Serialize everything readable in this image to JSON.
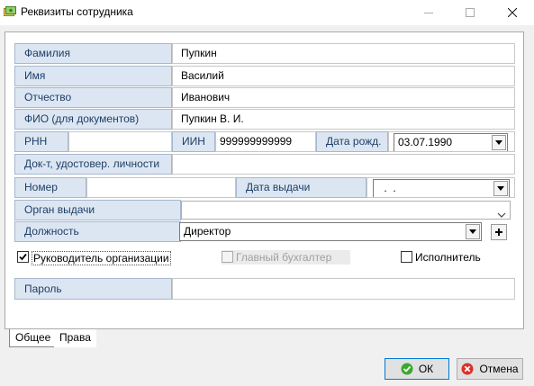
{
  "window": {
    "title": "Реквизиты сотрудника",
    "icons": [
      "app-icon",
      "minimize-icon",
      "maximize-icon",
      "close-icon"
    ]
  },
  "form": {
    "last_name": {
      "label": "Фамилия",
      "value": "Пупкин"
    },
    "first_name": {
      "label": "Имя",
      "value": "Василий"
    },
    "patronymic": {
      "label": "Отчество",
      "value": "Иванович"
    },
    "full_name_docs": {
      "label": "ФИО (для документов)",
      "value": "Пупкин В. И."
    },
    "rnn": {
      "label": "РНН",
      "value": ""
    },
    "iin": {
      "label": "ИИН",
      "value": "999999999999"
    },
    "birth_date": {
      "label": "Дата рожд.",
      "value": "03.07.1990"
    },
    "id_document": {
      "label": "Док-т, удостовер. личности",
      "value": ""
    },
    "doc_number": {
      "label": "Номер",
      "value": ""
    },
    "issue_date": {
      "label": "Дата выдачи",
      "value": " .  ."
    },
    "issuer": {
      "label": "Орган выдачи",
      "value": ""
    },
    "position": {
      "label": "Должность",
      "value": "Директор",
      "add_icon": "plus-icon"
    },
    "is_head": {
      "label": "Руководитель организации",
      "checked": true
    },
    "chief_accountant": {
      "label": "Главный бухгалтер",
      "checked": false,
      "disabled": true
    },
    "executor": {
      "label": "Исполнитель",
      "checked": false
    },
    "password": {
      "label": "Пароль",
      "value": ""
    }
  },
  "tabs": [
    {
      "label": "Общее",
      "active": true
    },
    {
      "label": "Права",
      "active": false
    }
  ],
  "buttons": {
    "ok": {
      "label": "ОК",
      "icon": "check-circle-icon",
      "color": "#3aa832"
    },
    "cancel": {
      "label": "Отмена",
      "icon": "cancel-circle-icon",
      "color": "#d9322b"
    }
  },
  "colors": {
    "label_bg": "#dce6f2",
    "label_text": "#1f3e66",
    "accent": "#0078d7"
  }
}
